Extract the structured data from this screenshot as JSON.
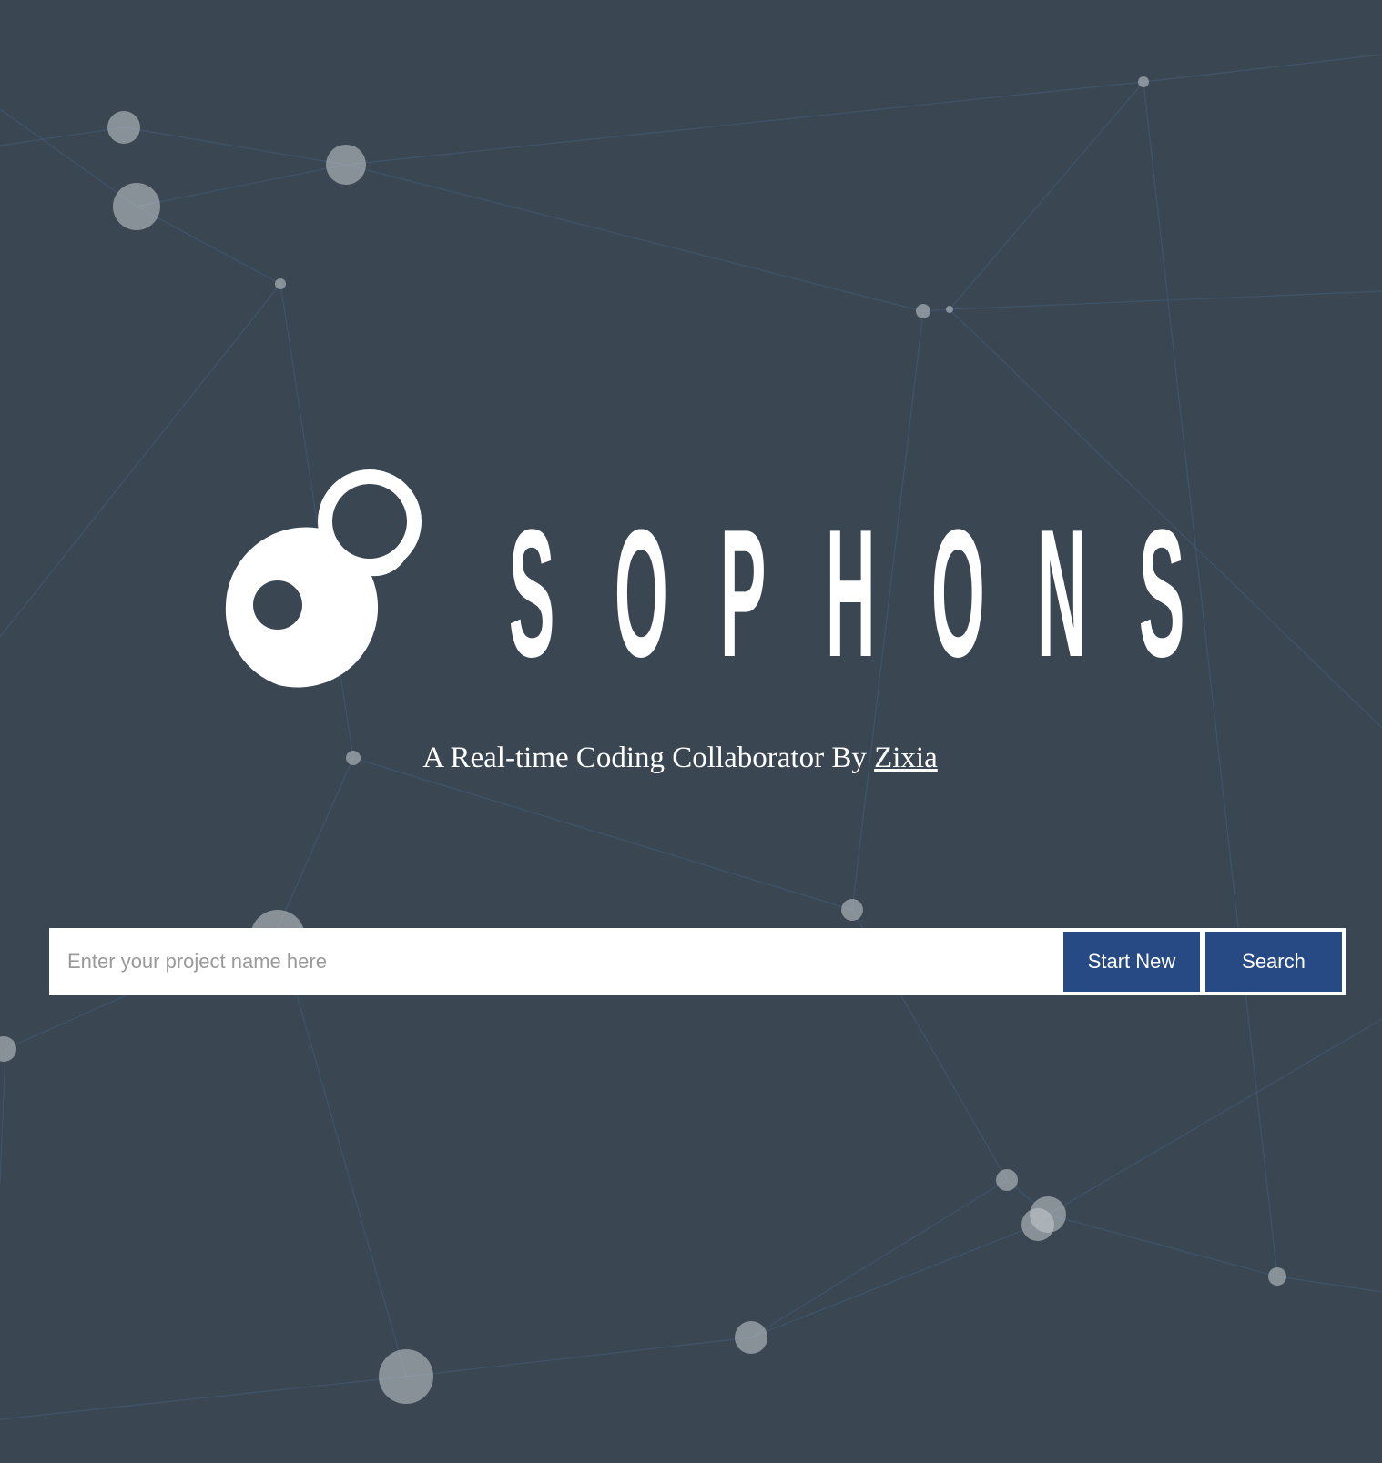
{
  "brand": {
    "name": "SOPHONS",
    "letters": [
      "S",
      "O",
      "P",
      "H",
      "O",
      "N",
      "S"
    ],
    "logo_color": "#ffffff"
  },
  "tagline": {
    "text": "A Real-time Coding Collaborator By ",
    "author_link": "Zixia"
  },
  "search": {
    "placeholder": "Enter your project name here",
    "value": "",
    "start_new_label": "Start New",
    "search_label": "Search"
  },
  "colors": {
    "background": "#3a4753",
    "button": "#274a85",
    "network_lines": "#4a6a92",
    "network_nodes": "#c9cdd2"
  }
}
